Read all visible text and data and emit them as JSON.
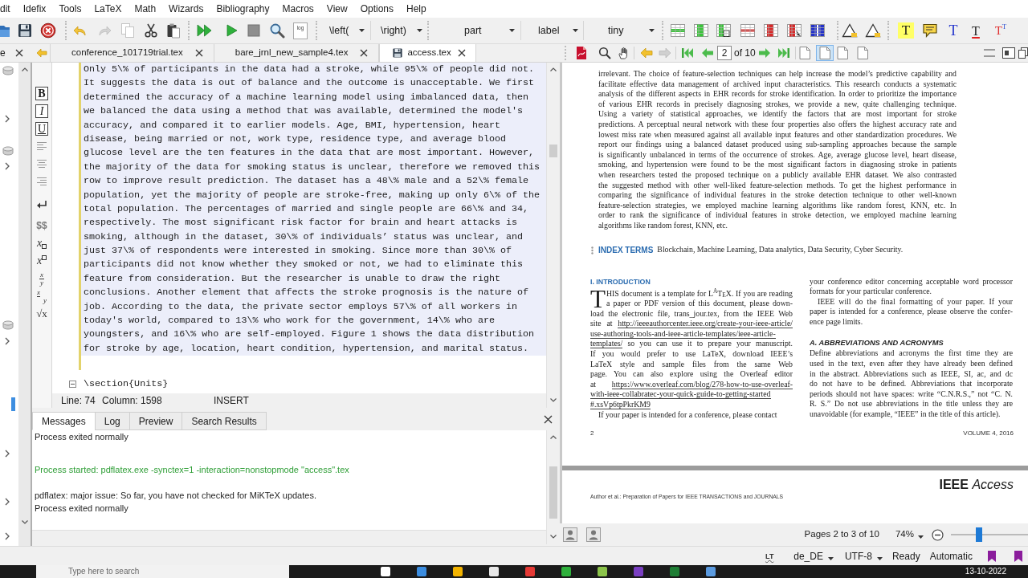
{
  "menu": [
    "dit",
    "Idefix",
    "Tools",
    "LaTeX",
    "Math",
    "Wizards",
    "Bibliography",
    "Macros",
    "View",
    "Options",
    "Help"
  ],
  "toolbar": {
    "edit_buttons": [
      {
        "kind": "undo",
        "disabled": false
      },
      {
        "kind": "redo",
        "disabled": true
      },
      {
        "kind": "copy",
        "disabled": true
      },
      {
        "kind": "cut",
        "disabled": false
      },
      {
        "kind": "paste",
        "disabled": false
      }
    ],
    "log_label": "log",
    "dropdowns": [
      {
        "kind": "left_delimiter",
        "value": "\\left("
      },
      {
        "kind": "right_delimiter",
        "value": "\\right)"
      },
      {
        "kind": "sectioning",
        "value": "part"
      },
      {
        "kind": "reference",
        "value": "label"
      },
      {
        "kind": "font_size",
        "value": "tiny"
      }
    ],
    "annotation_tools": [
      {
        "kind": "highlight",
        "glyph": "T"
      },
      {
        "kind": "comment"
      },
      {
        "kind": "text",
        "glyph": "T"
      },
      {
        "kind": "strikeout",
        "glyph": "T"
      },
      {
        "kind": "superscript",
        "glyph": "T",
        "glyph2": "T"
      }
    ]
  },
  "side_tab": {
    "label": "e"
  },
  "tabs": [
    {
      "label": "conference_101719trial.tex",
      "selected": false,
      "modified": false
    },
    {
      "label": "bare_jrnl_new_sample4.tex",
      "selected": false,
      "modified": false
    },
    {
      "label": "access.tex",
      "selected": true,
      "modified": true
    }
  ],
  "symbol_bar": [
    {
      "kind": "bold",
      "glyph": "B"
    },
    {
      "kind": "italic",
      "glyph": "I"
    },
    {
      "kind": "underline",
      "glyph": "U"
    },
    {
      "kind": "align_left"
    },
    {
      "kind": "align_center"
    },
    {
      "kind": "align_right"
    },
    {
      "kind": "newline"
    },
    {
      "kind": "math",
      "glyph": "$$"
    },
    {
      "kind": "subscript",
      "glyph": "x"
    },
    {
      "kind": "superscript",
      "glyph": "x"
    },
    {
      "kind": "fraction",
      "glyph": "x",
      "glyph2": "y"
    },
    {
      "kind": "slanted_fraction",
      "glyph": "x",
      "glyph2": "y"
    },
    {
      "kind": "sqrt",
      "glyph": "√x"
    }
  ],
  "editor": {
    "lines": [
      "Only 5\\% of participants in the data had a stroke, while 95\\% of people did not.",
      "It suggests the data is out of balance and the outcome is unacceptable. We first",
      "determined the accuracy of a machine learning model using imbalanced data, then",
      "we balanced the data using a method that was available, determined the model's",
      "accuracy, and compared it to earlier models. Age, BMI, hypertension, heart",
      "disease, being married or not, work type, residence type, and average blood",
      "glucose level are the ten features in the data that are most important. However,",
      "the majority of the data for smoking status is unclear, therefore we removed this",
      "row to improve result prediction. The dataset has a 48\\% male and a 52\\% female",
      "population, yet the majority of people are stroke-free, making up only 6\\% of the",
      "total population. The percentages of married and single people are 66\\% and 34,",
      "respectively. The most significant risk factor for brain and heart attacks is",
      "smoking, although in the dataset, 30\\% of individuals’ status was unclear, and",
      "just 37\\% of respondents were interested in smoking. Since more than 30\\% of",
      "participants did not know whether they smoked or not, we had to eliminate this",
      "feature from consideration. But the researcher is unable to draw the right",
      "conclusions. Another element that affects the stroke prognosis is the nature of",
      "job. According to the data, the private sector employs 57\\% of all workers in",
      "today's world, compared to 13\\% who work for the government, 14\\% who are",
      "youngsters, and 16\\% who are self-employed. Figure 1 shows the data distribution",
      "for stroke by age, location, heart condition, hypertension, and marital status."
    ],
    "next_line": "\\section{Units}"
  },
  "editor_status": {
    "line": "Line: 74",
    "column": "Column: 1598",
    "mode": "INSERT"
  },
  "messages": {
    "tabs": [
      {
        "label": "Messages",
        "selected": true
      },
      {
        "label": "Log",
        "selected": false
      },
      {
        "label": "Preview",
        "selected": false
      },
      {
        "label": "Search Results",
        "selected": false
      }
    ],
    "lines": [
      {
        "kind": "output",
        "text": "Process exited normally"
      },
      {
        "kind": "started",
        "text": "Process started: pdflatex.exe -synctex=1 -interaction=nonstopmode \"access\".tex"
      },
      {
        "kind": "output",
        "text": "pdflatex: major issue: So far, you have not checked for MiKTeX updates."
      },
      {
        "kind": "output",
        "text": "Process exited normally"
      }
    ]
  },
  "pdf_toolbar": {
    "nav_buttons": [
      {
        "kind": "back",
        "disabled": false
      },
      {
        "kind": "forward",
        "disabled": true
      }
    ],
    "page": "2",
    "page_count": "of 10",
    "view_modes": [
      {
        "selected": false
      },
      {
        "selected": true
      },
      {
        "selected": false
      },
      {
        "selected": false
      }
    ]
  },
  "pdf": {
    "abstract_lines": [
      "irrelevant. The choice of feature-selection techniques can help increase the model’s predictive capability and",
      "facilitate effective data management of archived input characteristics. This research conducts a systematic",
      "analysis of the different aspects in EHR records for stroke identification. In order to prioritize the importance",
      "of various EHR records in precisely diagnosing strokes, we provide a new, quite challenging technique.",
      "Using a variety of statistical approaches, we identify the factors that are most important for stroke",
      "predictions. A perceptual neural network with these four properties also offers the highest accuracy rate and",
      "lowest miss rate when measured against all available input features and other standardization procedures. We",
      "report our findings using a balanced dataset produced using sub-sampling approaches because the sample",
      "is significantly unbalanced in terms of the occurrence of strokes. Age, average glucose level, heart disease,",
      "smoking, and hypertension were found to be the most significant factors in diagnosing stroke in patients",
      "when researchers tested the proposed technique on a publicly available EHR dataset. We also contrasted",
      "the suggested method with other well-liked feature-selection methods. To get the highest performance in",
      "comparing the significance of individual features in the stroke detection technique to other well-known",
      "feature-selection strategies, we employed machine learning algorithms like random forest, KNN, etc. In",
      "order to rank the significance of individual features in stroke detection, we employed machine learning",
      "algorithms like random forest, KNN, etc."
    ],
    "index_terms": {
      "label": "INDEX TERMS",
      "text": "Blockchain, Machine Learning, Data analytics, Data Security, Cyber Security."
    },
    "columns": [
      [
        {
          "kind": "section",
          "text": "I. INTRODUCTION"
        },
        {
          "kind": "paragraph",
          "indent": false,
          "drop_cap": "T",
          "lines": [
            "HIS document is a template for L$^{A}$T$_{E}$X. If you are reading",
            "a paper or PDF version of this document, please down-",
            "load the electronic file, trans_jour.tex, from the IEEE Web",
            [
              {
                "kind": "text",
                "text": "site at "
              },
              {
                "kind": "link",
                "text": "http://ieeeauthorcenter.ieee.org/create-your-ieee-article/"
              }
            ],
            [
              {
                "kind": "link",
                "text": "use-authoring-tools-and-ieee-article-templates/ieee-article-"
              }
            ],
            [
              {
                "kind": "link",
                "text": "templates/"
              },
              {
                "kind": "text",
                "text": " so you can use it to prepare your manuscript."
              }
            ],
            "If you would prefer to use LaTeX, download IEEE’s",
            "LaTeX style and sample files from the same Web",
            "page. You can also explore using the Overleaf editor",
            [
              {
                "kind": "text",
                "text": "at "
              },
              {
                "kind": "link",
                "text": "https://www.overleaf.com/blog/278-how-to-use-overleaf-"
              }
            ],
            [
              {
                "kind": "link",
                "text": "with-ieee-collabratec-your-quick-guide-to-getting-started"
              }
            ],
            [
              {
                "kind": "link",
                "text": "#.xsVp6tpPkrKM9"
              }
            ]
          ]
        },
        {
          "kind": "paragraph",
          "indent": true,
          "lines": [
            "If your paper is intended for a conference, please contact"
          ]
        }
      ],
      [
        {
          "kind": "paragraph",
          "indent": false,
          "lines": [
            "your conference editor concerning acceptable word processor",
            "formats for your particular conference."
          ]
        },
        {
          "kind": "paragraph",
          "indent": true,
          "lines": [
            "IEEE will do the final formatting of your paper. If your",
            "paper is intended for a conference, please observe the confer-",
            "ence page limits."
          ]
        },
        {
          "kind": "subsection",
          "text": "A. ABBREVIATIONS AND ACRONYMS"
        },
        {
          "kind": "paragraph",
          "indent": false,
          "lines": [
            "Define abbreviations and acronyms the first time they are",
            "used in the text, even after they have already been defined",
            "in the abstract. Abbreviations such as IEEE, SI, ac, and dc",
            "do not have to be defined. Abbreviations that incorporate",
            "periods should not have spaces: write “C.N.R.S.,” not “C. N.",
            "R. S.” Do not use abbreviations in the title unless they are",
            "unavoidable (for example, “IEEE” in the title of this article)."
          ]
        }
      ]
    ],
    "page_number": "2",
    "volume": "VOLUME 4, 2016",
    "running_head": "Author et al.: Preparation of Papers for IEEE TRANSACTIONS and JOURNALS",
    "logo": "**IEEE** *Access*"
  },
  "pdf_status": {
    "pages": "Pages 2 to 3 of 10",
    "zoom": "74%",
    "zoom_slider": {
      "level": 0.35
    }
  },
  "status_bar": {
    "grammar_label": "LT",
    "language": "de_DE",
    "encoding": "UTF-8",
    "state": "Ready",
    "mode": "Automatic"
  },
  "taskbar": {
    "search_placeholder": "Type here to search",
    "date": "13-10-2022"
  }
}
